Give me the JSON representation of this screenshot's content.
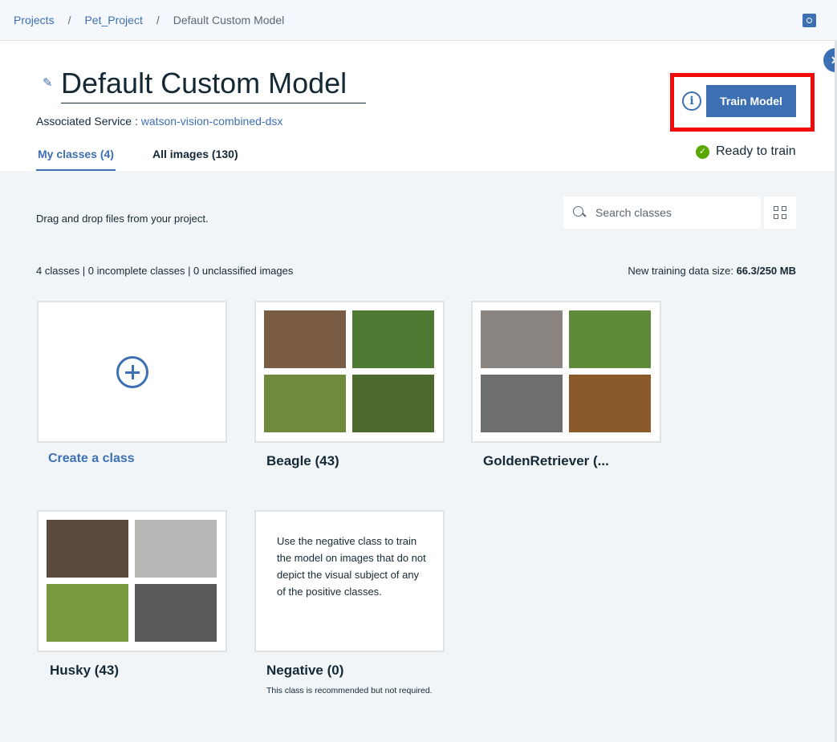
{
  "breadcrumb": {
    "projects": "Projects",
    "project": "Pet_Project",
    "current": "Default Custom Model",
    "separator": "/"
  },
  "header": {
    "title": "Default Custom Model",
    "associated_label": "Associated Service :",
    "associated_service": "watson-vision-combined-dsx",
    "tabs": [
      {
        "label": "My classes (4)",
        "active": true
      },
      {
        "label": "All images (130)",
        "active": false
      }
    ],
    "train_button": "Train Model",
    "info_glyph": "i",
    "status": "Ready to train",
    "status_color": "#5aa700"
  },
  "toolbar": {
    "dragdrop_hint": "Drag and drop files from your project.",
    "search_placeholder": "Search classes"
  },
  "stats": {
    "summary": "4 classes | 0 incomplete classes | 0 unclassified images",
    "datasize_label": "New training data size:",
    "datasize_value": "66.3/250 MB"
  },
  "create": {
    "label": "Create a class"
  },
  "classes": [
    {
      "label": "Beagle (43)",
      "thumb_colors": [
        "#7a5b44",
        "#4f7a34",
        "#6f8a3c",
        "#4d6a2e"
      ]
    },
    {
      "label": "GoldenRetriever (...",
      "thumb_colors": [
        "#8a8580",
        "#5f8a3a",
        "#6d6e6f",
        "#8a5a2a"
      ]
    },
    {
      "label": "Husky (43)",
      "thumb_colors": [
        "#5c4a3e",
        "#b8b8b6",
        "#7a9a40",
        "#5a5a5a"
      ]
    }
  ],
  "negative": {
    "label": "Negative (0)",
    "description": "Use the negative class to train the model on images that do not depict the visual subject of any of the positive classes.",
    "note": "This class is recommended but not required."
  },
  "colors": {
    "accent": "#3d70b2",
    "highlight": "#f20b0b",
    "background": "#f2f5f8"
  },
  "icons": [
    "edit-icon",
    "settings-icon",
    "info-icon",
    "check-icon",
    "search-icon",
    "grid-view-icon",
    "add-icon",
    "close-icon"
  ]
}
